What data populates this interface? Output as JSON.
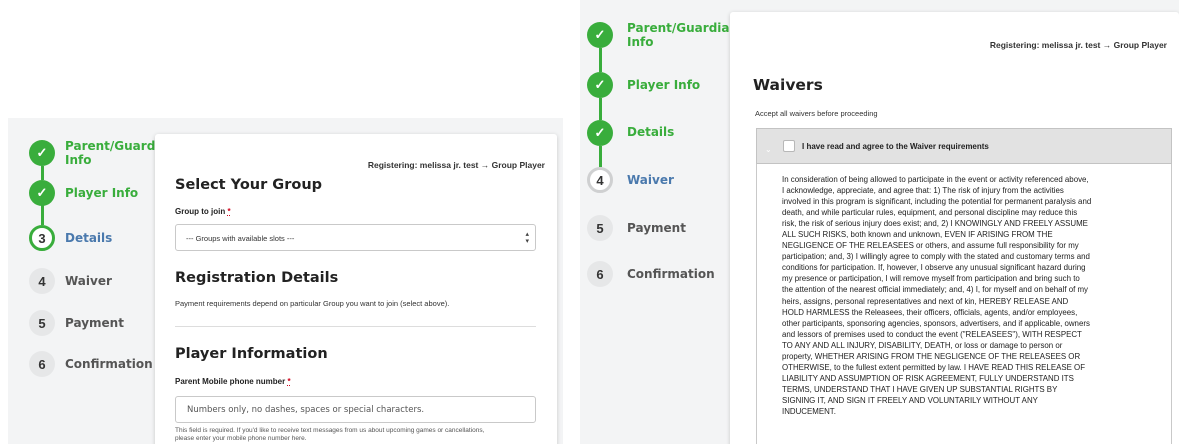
{
  "left": {
    "steps": [
      {
        "number": "1",
        "label": "Parent/Guardian Info",
        "state": "done"
      },
      {
        "number": "2",
        "label": "Player Info",
        "state": "done"
      },
      {
        "number": "3",
        "label": "Details",
        "state": "active"
      },
      {
        "number": "4",
        "label": "Waiver",
        "state": "todo"
      },
      {
        "number": "5",
        "label": "Payment",
        "state": "todo"
      },
      {
        "number": "6",
        "label": "Confirmation",
        "state": "todo"
      }
    ],
    "registering": "Registering: melissa jr. test → Group Player",
    "select_group_title": "Select Your Group",
    "group_label": "Group to join",
    "required_mark": "*",
    "group_select_value": "--- Groups with available slots ---",
    "registration_details_title": "Registration Details",
    "payment_note": "Payment requirements depend on particular Group you want to join (select above).",
    "player_info_title": "Player Information",
    "phone_label": "Parent Mobile phone number",
    "phone_placeholder": "Numbers only, no dashes, spaces or special characters.",
    "help_text": "This field is required. If you'd like to receive text messages from us about upcoming games or cancellations, please enter your mobile phone number here."
  },
  "right": {
    "steps": [
      {
        "number": "1",
        "label": "Parent/Guardian Info",
        "state": "done"
      },
      {
        "number": "2",
        "label": "Player Info",
        "state": "done"
      },
      {
        "number": "3",
        "label": "Details",
        "state": "done"
      },
      {
        "number": "4",
        "label": "Waiver",
        "state": "active"
      },
      {
        "number": "5",
        "label": "Payment",
        "state": "todo"
      },
      {
        "number": "6",
        "label": "Confirmation",
        "state": "todo"
      }
    ],
    "registering": "Registering: melissa jr. test → Group Player",
    "waivers_title": "Waivers",
    "accept_note": "Accept all waivers before proceeding",
    "waiver_checkbox_label": "I have read and agree to the Waiver requirements",
    "waiver_text": "In consideration of being allowed to participate in the event or activity referenced above,\nI acknowledge, appreciate, and agree that: 1) The risk of injury from the activities\ninvolved in this program is significant, including the potential for permanent paralysis and\ndeath, and while particular rules, equipment, and personal discipline may reduce this\nrisk, the risk of serious injury does exist; and, 2) I KNOWINGLY AND FREELY ASSUME\nALL SUCH RISKS, both known and unknown, EVEN IF ARISING FROM THE\nNEGLIGENCE OF THE RELEASEES or others, and assume full responsibility for my\nparticipation; and, 3) I willingly agree to comply with the stated and customary terms and\nconditions for participation. If, however, I observe any unusual significant hazard during\nmy presence or participation, I will remove myself from participation and bring such to\nthe attention of the nearest official immediately; and, 4) I, for myself and on behalf of my\nheirs, assigns, personal representatives and next of kin, HEREBY RELEASE AND\nHOLD HARMLESS the Releasees, their officers, officials, agents, and/or employees,\nother participants, sponsoring agencies, sponsors, advertisers, and if applicable, owners\nand lessors of premises used to conduct the event (\"RELEASEES\"), WITH RESPECT\nTO ANY AND ALL INJURY, DISABILITY, DEATH, or loss or damage to person or\nproperty, WHETHER ARISING FROM THE NEGLIGENCE OF THE RELEASEES OR\nOTHERWISE, to the fullest extent permitted by law. I HAVE READ THIS RELEASE OF\nLIABILITY AND ASSUMPTION OF RISK AGREEMENT, FULLY UNDERSTAND ITS\nTERMS, UNDERSTAND THAT I HAVE GIVEN UP SUBSTANTIAL RIGHTS BY\nSIGNING IT, AND SIGN IT FREELY AND VOLUNTARILY WITHOUT ANY\nINDUCEMENT."
  },
  "icons": {
    "check": "check-icon",
    "chevron": "chevron-down-icon",
    "select_arrows": "select-arrows-icon"
  },
  "colors": {
    "accent_green": "#39ad3c",
    "active_blue": "#4a79ad",
    "required_red": "#d0021b",
    "panel_bg": "#f3f4f5"
  }
}
